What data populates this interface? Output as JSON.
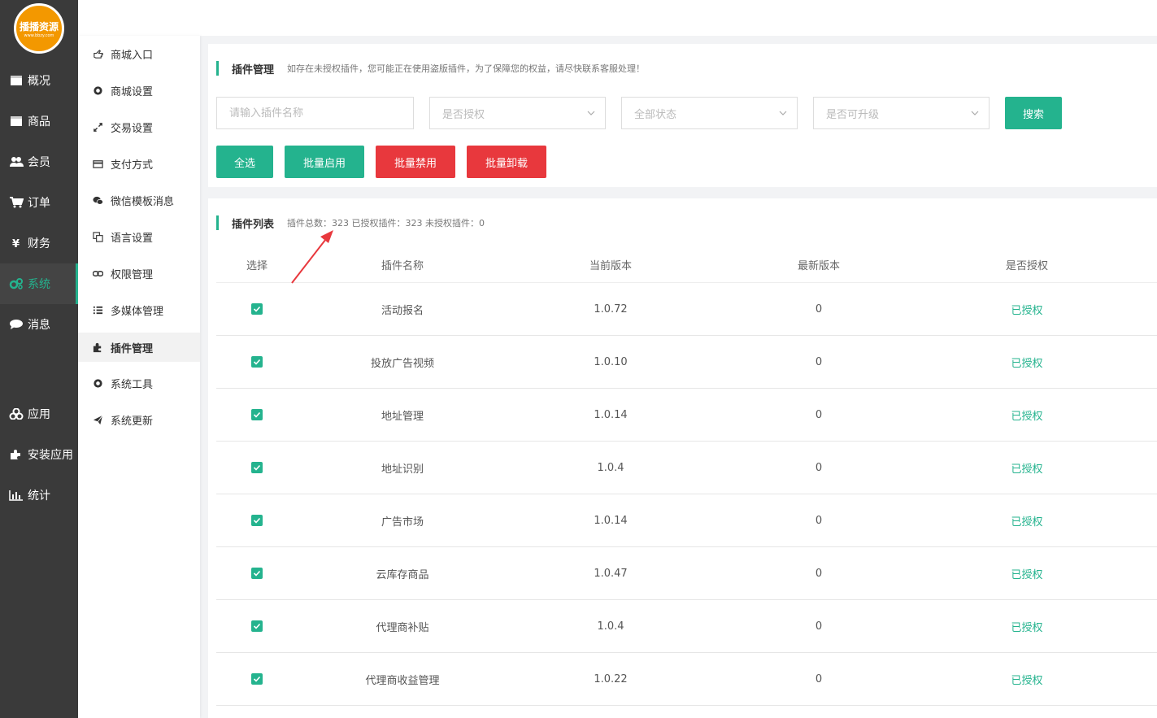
{
  "logo": {
    "text": "播播资源",
    "sub": "www.bbzy.com"
  },
  "nav": [
    {
      "label": "概况",
      "icon": "overview-icon"
    },
    {
      "label": "商品",
      "icon": "goods-icon"
    },
    {
      "label": "会员",
      "icon": "users-icon"
    },
    {
      "label": "订单",
      "icon": "cart-icon"
    },
    {
      "label": "财务",
      "icon": "yen-icon"
    },
    {
      "label": "系统",
      "icon": "gears-icon",
      "active": true
    },
    {
      "label": "消息",
      "icon": "comment-icon"
    },
    {
      "label": "应用",
      "icon": "apps-icon"
    },
    {
      "label": "安装应用",
      "icon": "puzzle-icon"
    },
    {
      "label": "统计",
      "icon": "chart-icon"
    }
  ],
  "submenu": [
    {
      "label": "商城入口",
      "icon": "hand-point-icon"
    },
    {
      "label": "商城设置",
      "icon": "gear-icon"
    },
    {
      "label": "交易设置",
      "icon": "arrows-icon"
    },
    {
      "label": "支付方式",
      "icon": "card-icon"
    },
    {
      "label": "微信模板消息",
      "icon": "wechat-icon"
    },
    {
      "label": "语言设置",
      "icon": "language-icon"
    },
    {
      "label": "权限管理",
      "icon": "link-icon"
    },
    {
      "label": "多媒体管理",
      "icon": "list-icon"
    },
    {
      "label": "插件管理",
      "icon": "puzzle-icon",
      "active": true
    },
    {
      "label": "系统工具",
      "icon": "gear-icon"
    },
    {
      "label": "系统更新",
      "icon": "send-icon"
    }
  ],
  "plugin_manage": {
    "title": "插件管理",
    "notice": "如存在未授权插件，您可能正在使用盗版插件，为了保障您的权益，请尽快联系客服处理！",
    "search_placeholder": "请输入插件名称",
    "filter_auth": "是否授权",
    "filter_status": "全部状态",
    "filter_upgrade": "是否可升级",
    "search_button": "搜索",
    "select_all": "全选",
    "batch_enable": "批量启用",
    "batch_disable": "批量禁用",
    "batch_uninstall": "批量卸载"
  },
  "plugin_list": {
    "title": "插件列表",
    "summary": "插件总数：323 已授权插件：323 未授权插件：0",
    "columns": [
      "选择",
      "插件名称",
      "当前版本",
      "最新版本",
      "是否授权"
    ],
    "rows": [
      {
        "name": "活动报名",
        "version": "1.0.72",
        "latest": "0",
        "auth": "已授权"
      },
      {
        "name": "投放广告视频",
        "version": "1.0.10",
        "latest": "0",
        "auth": "已授权"
      },
      {
        "name": "地址管理",
        "version": "1.0.14",
        "latest": "0",
        "auth": "已授权"
      },
      {
        "name": "地址识别",
        "version": "1.0.4",
        "latest": "0",
        "auth": "已授权"
      },
      {
        "name": "广告市场",
        "version": "1.0.14",
        "latest": "0",
        "auth": "已授权"
      },
      {
        "name": "云库存商品",
        "version": "1.0.47",
        "latest": "0",
        "auth": "已授权"
      },
      {
        "name": "代理商补贴",
        "version": "1.0.4",
        "latest": "0",
        "auth": "已授权"
      },
      {
        "name": "代理商收益管理",
        "version": "1.0.22",
        "latest": "0",
        "auth": "已授权"
      }
    ]
  },
  "colors": {
    "accent": "#24b38e",
    "danger": "#e8383d",
    "sidebar": "#3a3a3a",
    "annotation": "#e8383d"
  }
}
